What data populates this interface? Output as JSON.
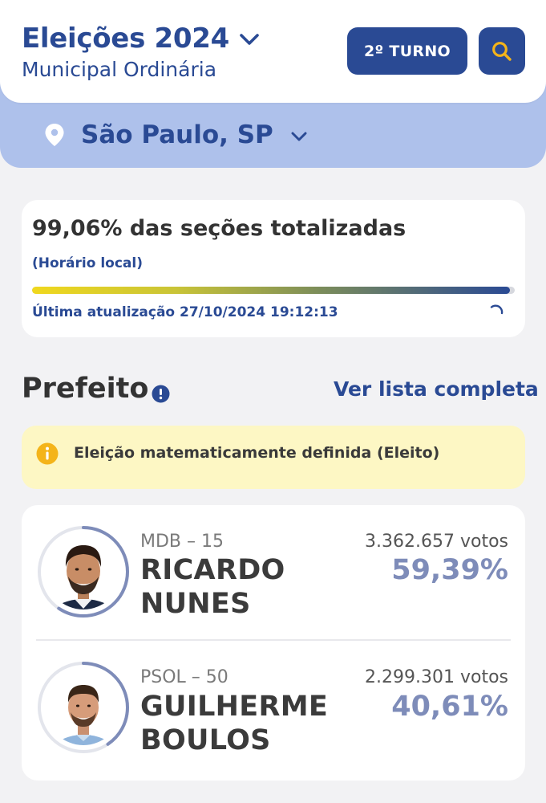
{
  "header": {
    "title": "Eleições 2024",
    "subtitle": "Municipal Ordinária",
    "turno_button": "2º TURNO",
    "search_icon": "search-icon"
  },
  "location": {
    "pin_icon": "location-pin-icon",
    "label": "São Paulo, SP"
  },
  "status": {
    "title": "99,06% das seções totalizadas",
    "subtitle": "(Horário local)",
    "progress_percent": 99.06,
    "last_update": "Última atualização 27/10/2024 19:12:13"
  },
  "section": {
    "title": "Prefeito",
    "see_all_link": "Ver lista completa"
  },
  "alert": {
    "text": "Eleição matematicamente definida (Eleito)"
  },
  "candidates": [
    {
      "party": "MDB – 15",
      "name": "RICARDO NUNES",
      "votes": "3.362.657 votos",
      "percent_label": "59,39%",
      "percent": 59.39
    },
    {
      "party": "PSOL – 50",
      "name": "GUILHERME BOULOS",
      "votes": "2.299.301 votos",
      "percent_label": "40,61%",
      "percent": 40.61
    }
  ],
  "colors": {
    "brand": "#2a4a94",
    "location_bar": "#aec1eb",
    "alert_bg": "#fdf7c4",
    "alert_icon": "#f4b41a",
    "percent_text": "#7e8cb9"
  }
}
